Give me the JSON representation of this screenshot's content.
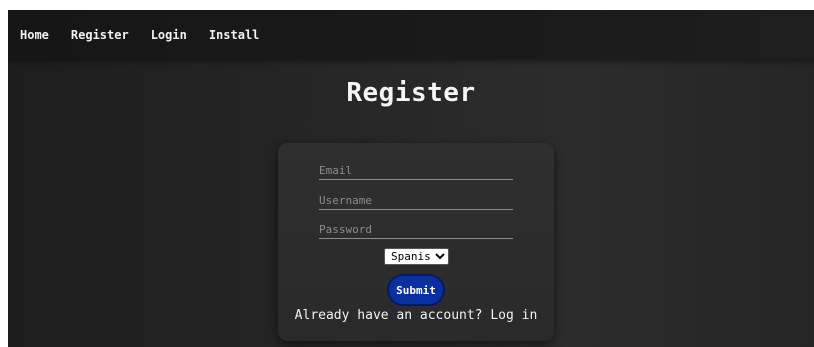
{
  "nav": {
    "items": [
      {
        "label": "Home"
      },
      {
        "label": "Register"
      },
      {
        "label": "Login"
      },
      {
        "label": "Install"
      }
    ]
  },
  "page": {
    "title": "Register"
  },
  "form": {
    "email": {
      "placeholder": "Email",
      "value": ""
    },
    "username": {
      "placeholder": "Username",
      "value": ""
    },
    "password": {
      "placeholder": "Password",
      "value": ""
    },
    "language": {
      "selected": "Spanish"
    },
    "submit_label": "Submit",
    "login_prompt": "Already have an account?",
    "login_link": "Log in"
  },
  "colors": {
    "background": "#272727",
    "navbar": "#1a1a1a",
    "card": "#2d2d2d",
    "submit": "#0a2fa0",
    "text": "#f2f2f2"
  }
}
